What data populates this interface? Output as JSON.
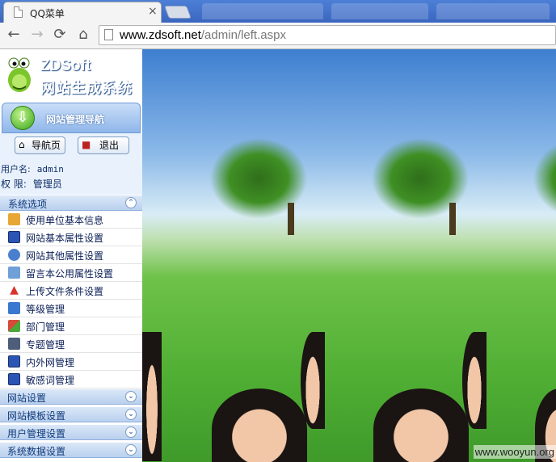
{
  "browser": {
    "tab_title": "QQ菜单",
    "tab_close": "×",
    "url_host": "www.zdsoft.net",
    "url_path": "/admin/left.aspx"
  },
  "logo": {
    "title": "ZDSoft",
    "subtitle": "网站生成系统"
  },
  "nav": {
    "header_title": "网站管理导航",
    "home_button": "导航页",
    "logout_button": "退出",
    "username_label": "用户名:",
    "username_value": "admin",
    "role_label": "权 限:",
    "role_value": "管理员"
  },
  "sections": {
    "system_options": "系统选项",
    "site_settings": "网站设置",
    "site_templates": "网站模板设置",
    "user_management": "用户管理设置",
    "system_data": "系统数据设置"
  },
  "items": [
    {
      "label": "使用单位基本信息",
      "icon": "box-icon",
      "color": "#e8a735"
    },
    {
      "label": "网站基本属性设置",
      "icon": "monitor-icon",
      "color": "#2a55b5"
    },
    {
      "label": "网站其他属性设置",
      "icon": "users-icon",
      "color": "#4a7fd0"
    },
    {
      "label": "留言本公用属性设置",
      "icon": "note-icon",
      "color": "#6fa0d8"
    },
    {
      "label": "上传文件条件设置",
      "icon": "upload-icon",
      "color": "#d8342c"
    },
    {
      "label": "等级管理",
      "icon": "accessibility-icon",
      "color": "#3a78d0"
    },
    {
      "label": "部门管理",
      "icon": "blocks-icon",
      "color": "#d84a3a"
    },
    {
      "label": "专题管理",
      "icon": "tools-icon",
      "color": "#4d5d7a"
    },
    {
      "label": "内外网管理",
      "icon": "network-icon",
      "color": "#2a55b5"
    },
    {
      "label": "敏感词管理",
      "icon": "monitor-icon",
      "color": "#2a55b5"
    }
  ],
  "watermark": "www.wooyun.org"
}
